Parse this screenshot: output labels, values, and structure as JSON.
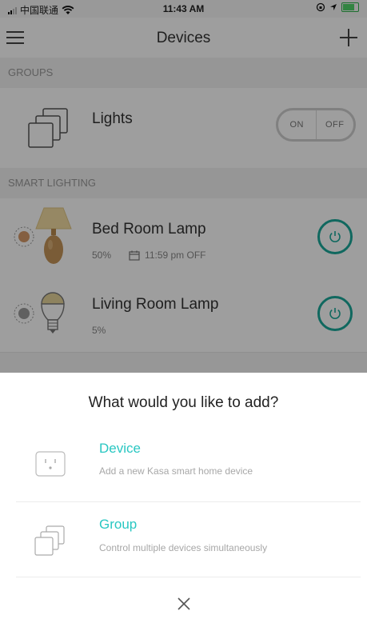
{
  "status_bar": {
    "carrier": "中国联通",
    "time": "11:43 AM"
  },
  "header": {
    "title": "Devices"
  },
  "sections": {
    "groups": {
      "label": "GROUPS",
      "items": [
        {
          "name": "Lights",
          "on_label": "ON",
          "off_label": "OFF"
        }
      ]
    },
    "smart_lighting": {
      "label": "SMART LIGHTING",
      "items": [
        {
          "name": "Bed Room Lamp",
          "brightness": "50%",
          "schedule": "11:59 pm OFF",
          "bulb_color": "#d59a6a"
        },
        {
          "name": "Living Room Lamp",
          "brightness": "5%",
          "bulb_color": "#9b9b9b"
        }
      ]
    }
  },
  "sheet": {
    "title": "What would you like to add?",
    "options": [
      {
        "title": "Device",
        "description": "Add a new Kasa smart home device"
      },
      {
        "title": "Group",
        "description": "Control multiple devices simultaneously"
      }
    ]
  },
  "colors": {
    "accent": "#29c7c2",
    "power": "#1aa89a"
  },
  "icons": {
    "menu": "menu-icon",
    "add": "plus-icon",
    "group": "stacked-squares-icon",
    "power": "power-icon",
    "calendar": "calendar-icon",
    "outlet": "outlet-icon",
    "close": "close-icon"
  }
}
